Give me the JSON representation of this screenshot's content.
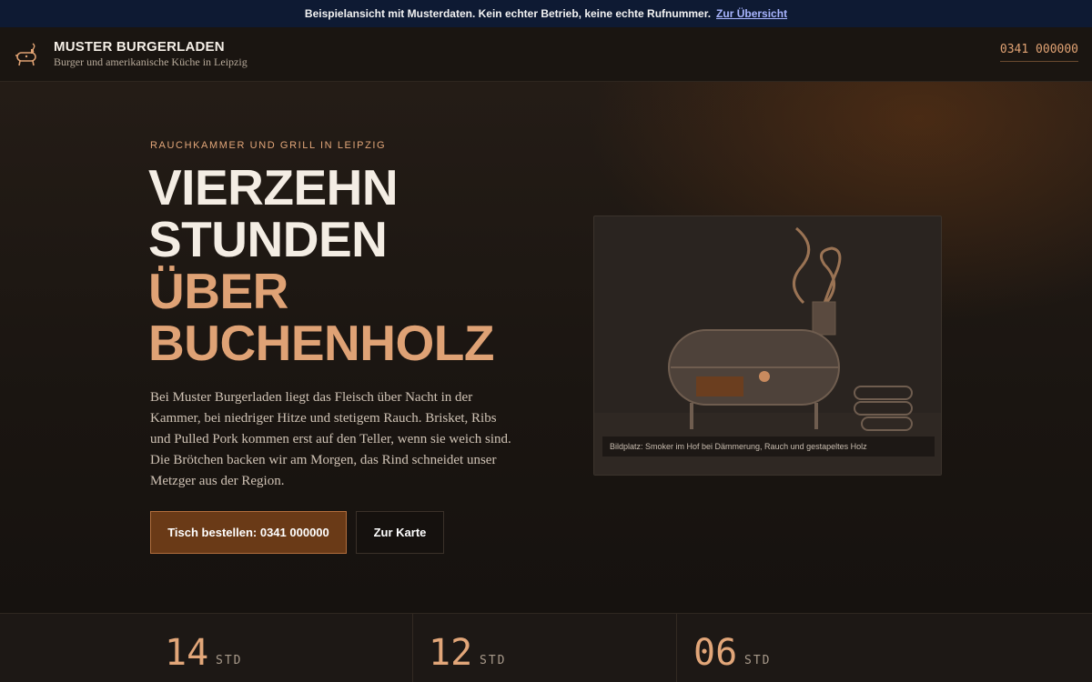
{
  "banner": {
    "text": "Beispielansicht mit Musterdaten. Kein echter Betrieb, keine echte Rufnummer.",
    "link": "Zur Übersicht"
  },
  "header": {
    "title": "MUSTER BURGERLADEN",
    "subtitle": "Burger und amerikanische Küche in Leipzig",
    "phone": "0341 000000",
    "logo_icon": "smoker-grill-icon"
  },
  "hero": {
    "eyebrow": "RAUCHKAMMER UND GRILL IN LEIPZIG",
    "headline_line1": "VIERZEHN",
    "headline_line2": "STUNDEN",
    "headline_line3": "ÜBER",
    "headline_line4": "BUCHENHOLZ",
    "lead": "Bei Muster Burgerladen liegt das Fleisch über Nacht in der Kammer, bei niedriger Hitze und stetigem Rauch. Brisket, Ribs und Pulled Pork kommen erst auf den Teller, wenn sie weich sind. Die Brötchen backen wir am Morgen, das Rind schneidet unser Metzger aus der Region.",
    "primary_button": "Tisch bestellen: 0341 000000",
    "secondary_button": "Zur Karte",
    "image_caption": "Bildplatz: Smoker im Hof bei Dämmerung, Rauch und gestapeltes Holz"
  },
  "stats": [
    {
      "value": "14",
      "unit": "STD"
    },
    {
      "value": "12",
      "unit": "STD"
    },
    {
      "value": "06",
      "unit": "STD"
    }
  ],
  "colors": {
    "accent": "#dfa275",
    "banner_bg": "#0e1a33",
    "primary_button_bg": "#6a3a17"
  }
}
